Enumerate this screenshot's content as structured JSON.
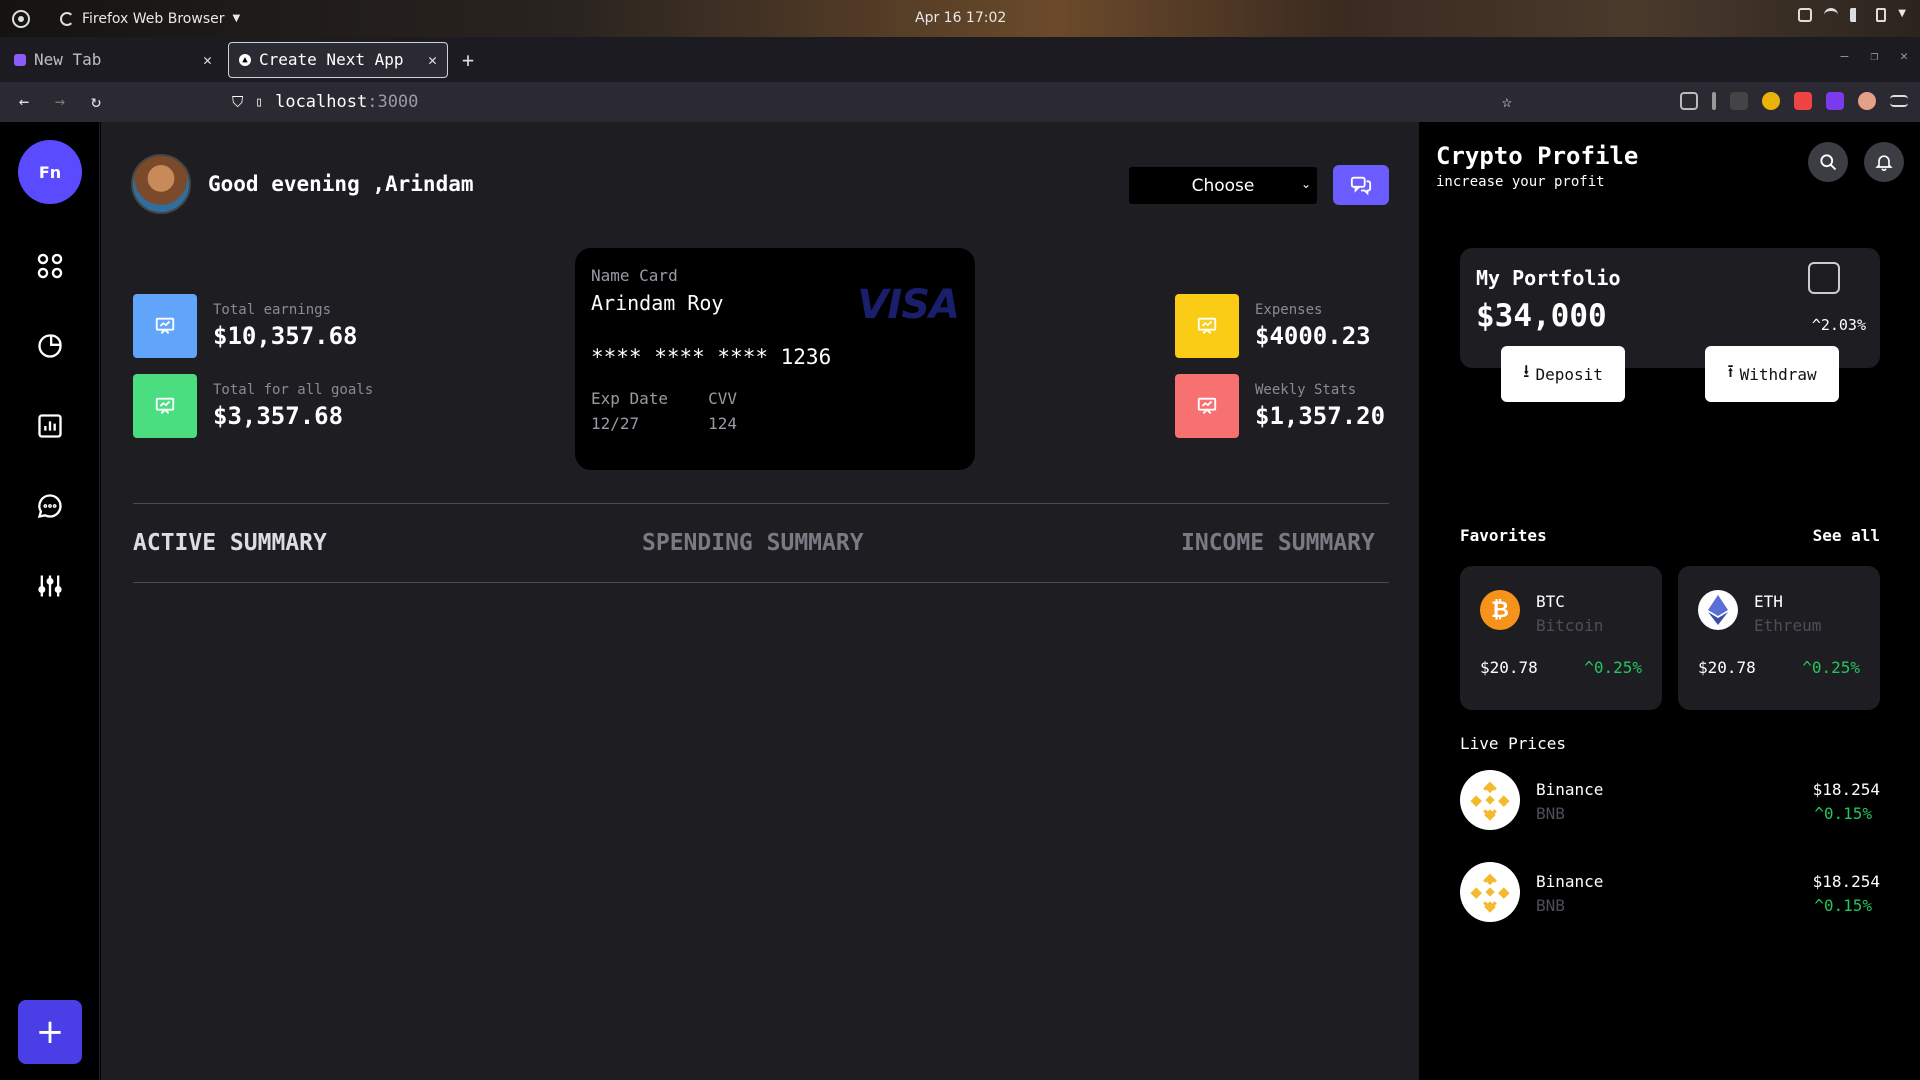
{
  "system": {
    "app_name": "Firefox Web Browser",
    "clock": "Apr 16 17:02"
  },
  "browser": {
    "tabs": [
      {
        "label": "New Tab"
      },
      {
        "label": "Create Next App"
      }
    ],
    "url_host": "localhost",
    "url_port": ":3000"
  },
  "sidebar": {
    "logo_text": "Fn",
    "add_label": "+",
    "icons": [
      "grid-icon",
      "pie-chart-icon",
      "bar-chart-icon",
      "message-icon",
      "sliders-icon"
    ]
  },
  "header": {
    "greeting": "Good evening ,Arindam",
    "select_value": "Choose"
  },
  "stats": [
    {
      "label": "Total earnings",
      "value": "$10,357.68",
      "color": "#60a5fa"
    },
    {
      "label": "Total for all goals",
      "value": "$3,357.68",
      "color": "#4ade80"
    },
    {
      "label": "Expenses",
      "value": "$4000.23",
      "color": "#facc15"
    },
    {
      "label": "Weekly Stats",
      "value": "$1,357.20",
      "color": "#f87171"
    }
  ],
  "card": {
    "name_label": "Name Card",
    "name": "Arindam Roy",
    "number": "**** **** **** 1236",
    "brand": "VISA",
    "exp_label": "Exp Date",
    "exp_value": "12/27",
    "cvv_label": "CVV",
    "cvv_value": "124"
  },
  "summary_tabs": {
    "active": "ACTIVE SUMMARY",
    "spending": "SPENDING SUMMARY",
    "income": "INCOME SUMMARY"
  },
  "right_panel": {
    "title": "Crypto Profile",
    "subtitle": "increase your profit",
    "portfolio": {
      "title": "My Portfolio",
      "value": "$34,000",
      "change": "^2.03%",
      "deposit": "Deposit",
      "withdraw": "Withdraw"
    },
    "favorites_label": "Favorites",
    "see_all": "See all",
    "favorites": [
      {
        "symbol": "BTC",
        "name": "Bitcoin",
        "price": "$20.78",
        "change": "^0.25%",
        "color": "#f7931a"
      },
      {
        "symbol": "ETH",
        "name": "Ethreum",
        "price": "$20.78",
        "change": "^0.25%",
        "color": "#ffffff"
      }
    ],
    "live_label": "Live Prices",
    "live": [
      {
        "name": "Binance",
        "symbol": "BNB",
        "price": "$18.254",
        "change": "^0.15%"
      },
      {
        "name": "Binance",
        "symbol": "BNB",
        "price": "$18.254",
        "change": "^0.15%"
      }
    ]
  },
  "colors": {
    "accent": "#6a5cff",
    "positive": "#22c55e",
    "panel": "#1e1e22"
  }
}
